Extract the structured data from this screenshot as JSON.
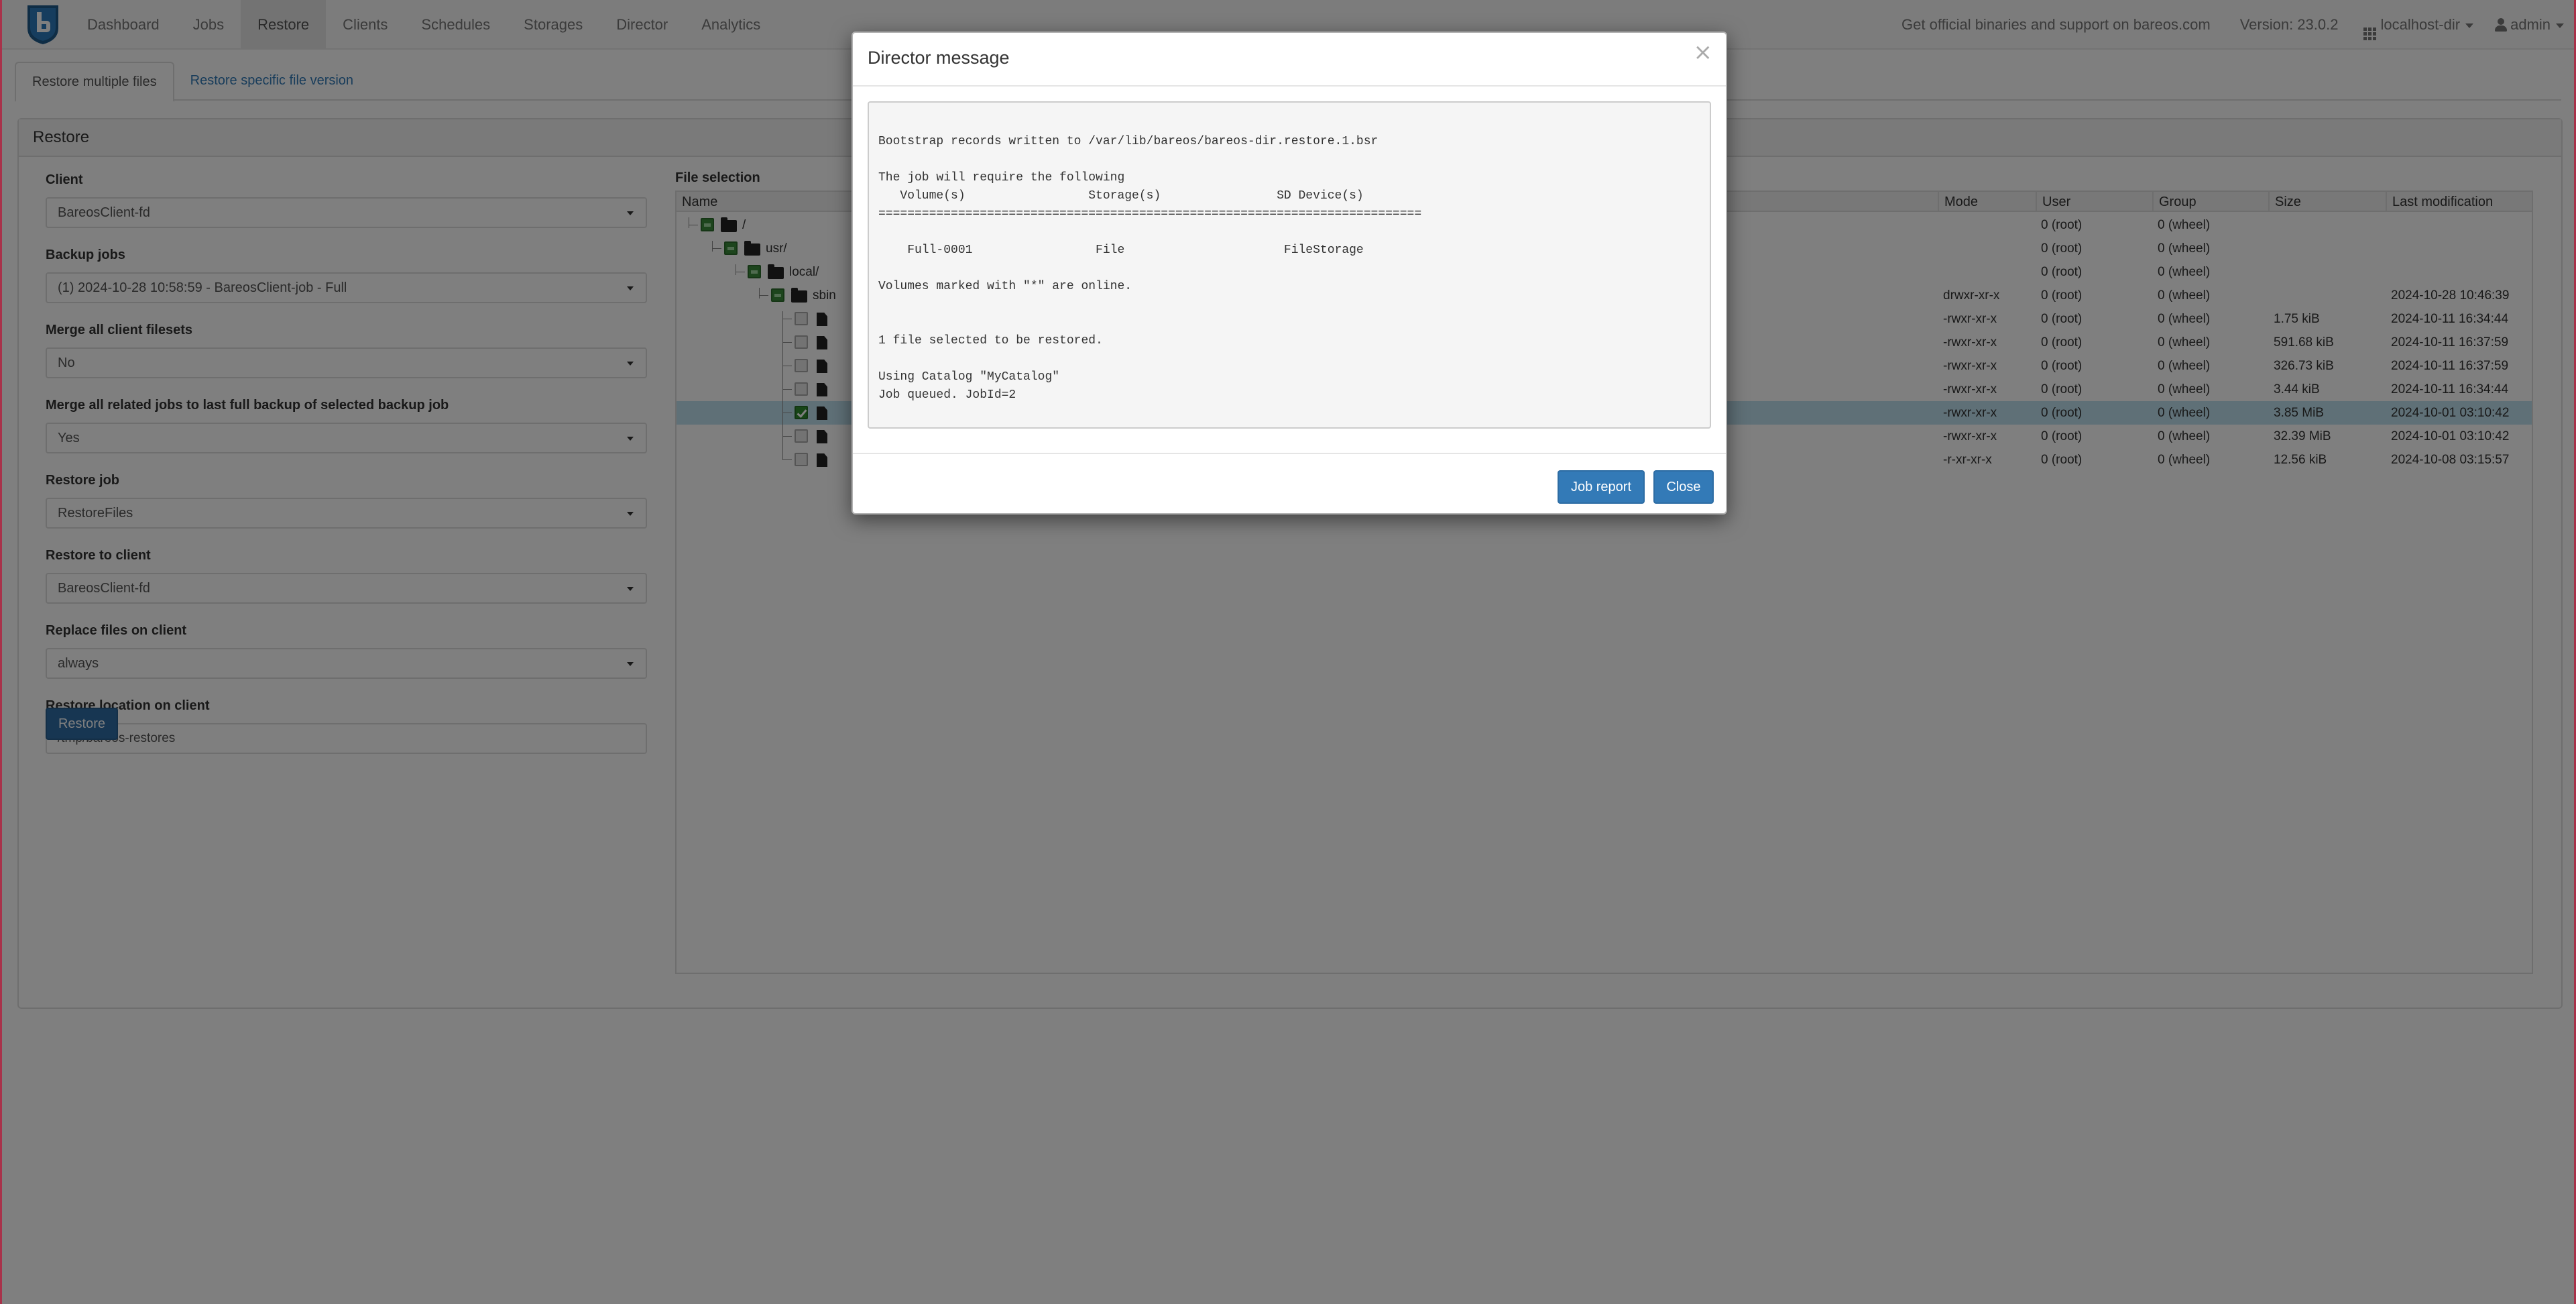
{
  "nav": {
    "items": [
      "Dashboard",
      "Jobs",
      "Restore",
      "Clients",
      "Schedules",
      "Storages",
      "Director",
      "Analytics"
    ],
    "support_text": "Get official binaries and support on bareos.com",
    "version": "Version: 23.0.2",
    "director": "localhost-dir",
    "user": "admin"
  },
  "tabs": [
    "Restore multiple files",
    "Restore specific file version"
  ],
  "panel": {
    "title": "Restore"
  },
  "form": {
    "client_label": "Client",
    "client_value": "BareosClient-fd",
    "backup_jobs_label": "Backup jobs",
    "backup_jobs_value": "(1) 2024-10-28 10:58:59 - BareosClient-job - Full",
    "merge_filesets_label": "Merge all client filesets",
    "merge_filesets_value": "No",
    "merge_jobs_label": "Merge all related jobs to last full backup of selected backup job",
    "merge_jobs_value": "Yes",
    "restore_job_label": "Restore job",
    "restore_job_value": "RestoreFiles",
    "restore_client_label": "Restore to client",
    "restore_client_value": "BareosClient-fd",
    "replace_label": "Replace files on client",
    "replace_value": "always",
    "location_label": "Restore location on client",
    "location_value": "/tmp/bareos-restores",
    "restore_button": "Restore"
  },
  "file_selection": {
    "title": "File selection",
    "columns": [
      "Name",
      "Mode",
      "User",
      "Group",
      "Size",
      "Last modification"
    ],
    "rows": [
      {
        "name": "/",
        "mode": "",
        "user": "0 (root)",
        "group": "0 (wheel)",
        "size": "",
        "modified": ""
      },
      {
        "name": "usr/",
        "mode": "",
        "user": "0 (root)",
        "group": "0 (wheel)",
        "size": "",
        "modified": ""
      },
      {
        "name": "local/",
        "mode": "",
        "user": "0 (root)",
        "group": "0 (wheel)",
        "size": "",
        "modified": ""
      },
      {
        "name": "sbin",
        "mode": "drwxr-xr-x",
        "user": "0 (root)",
        "group": "0 (wheel)",
        "size": "",
        "modified": "2024-10-28 10:46:39"
      },
      {
        "name": "",
        "mode": "-rwxr-xr-x",
        "user": "0 (root)",
        "group": "0 (wheel)",
        "size": "1.75 kiB",
        "modified": "2024-10-11 16:34:44"
      },
      {
        "name": "",
        "mode": "-rwxr-xr-x",
        "user": "0 (root)",
        "group": "0 (wheel)",
        "size": "591.68 kiB",
        "modified": "2024-10-11 16:37:59"
      },
      {
        "name": "",
        "mode": "-rwxr-xr-x",
        "user": "0 (root)",
        "group": "0 (wheel)",
        "size": "326.73 kiB",
        "modified": "2024-10-11 16:37:59"
      },
      {
        "name": "",
        "mode": "-rwxr-xr-x",
        "user": "0 (root)",
        "group": "0 (wheel)",
        "size": "3.44 kiB",
        "modified": "2024-10-11 16:34:44"
      },
      {
        "name": "",
        "mode": "-rwxr-xr-x",
        "user": "0 (root)",
        "group": "0 (wheel)",
        "size": "3.85 MiB",
        "modified": "2024-10-01 03:10:42"
      },
      {
        "name": "",
        "mode": "-rwxr-xr-x",
        "user": "0 (root)",
        "group": "0 (wheel)",
        "size": "32.39 MiB",
        "modified": "2024-10-01 03:10:42"
      },
      {
        "name": "",
        "mode": "-r-xr-xr-x",
        "user": "0 (root)",
        "group": "0 (wheel)",
        "size": "12.56 kiB",
        "modified": "2024-10-08 03:15:57"
      }
    ]
  },
  "modal": {
    "title": "Director message",
    "close_glyph": "×",
    "message": "\nBootstrap records written to /var/lib/bareos/bareos-dir.restore.1.bsr\n\nThe job will require the following\n   Volume(s)                 Storage(s)                SD Device(s)\n===========================================================================\n\n    Full-0001                 File                      FileStorage\n\nVolumes marked with \"*\" are online.\n\n\n1 file selected to be restored.\n\nUsing Catalog \"MyCatalog\"\nJob queued. JobId=2",
    "job_report_button": "Job report",
    "close_button": "Close"
  },
  "colors": {
    "primary": "#337ab7",
    "selected_row": "#bfe0ee",
    "accent_edge": "#a8324a"
  }
}
